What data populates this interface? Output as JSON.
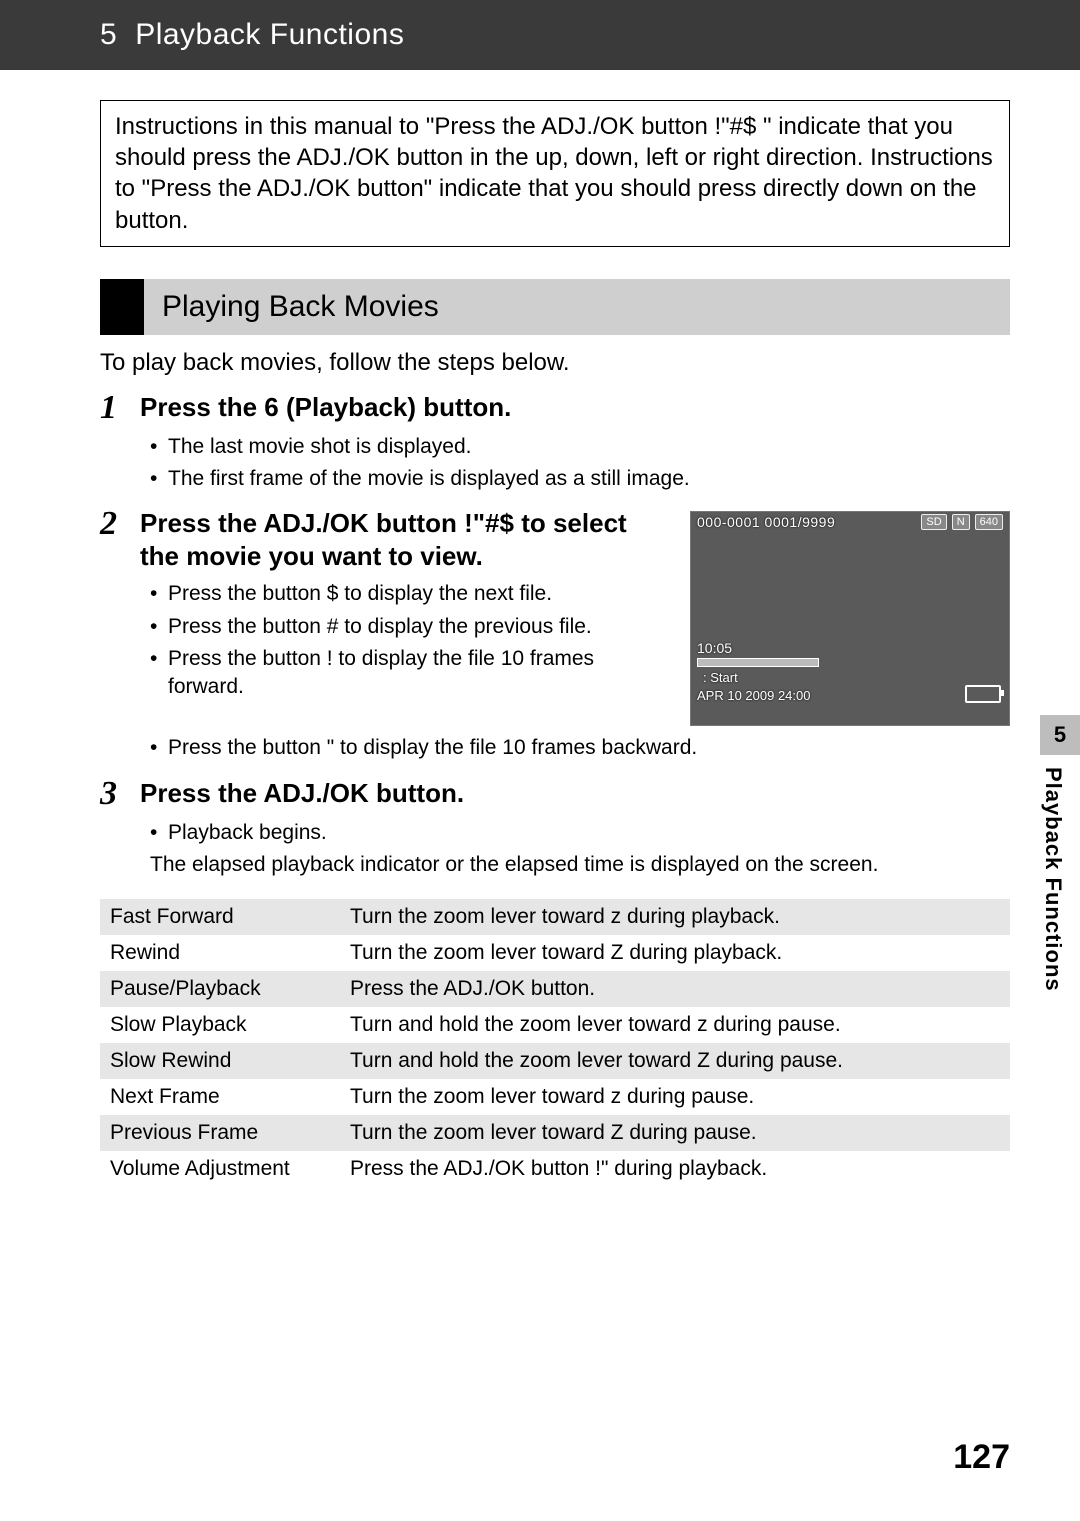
{
  "chapter": {
    "number": "5",
    "title": "Playback Functions"
  },
  "instruction_box": "Instructions in this manual to \"Press the ADJ./OK button !\"#$    \" indicate that you should press the ADJ./OK button in the up, down, left or right direction. Instructions to \"Press the ADJ./OK button\" indicate that you should press directly down on the button.",
  "section_title": "Playing Back Movies",
  "lead": "To play back movies, follow the steps below.",
  "steps": [
    {
      "num": "1",
      "title_pre": "Press the ",
      "title_sym": "6",
      "title_post": " (Playback) button.",
      "bullets": [
        "The last movie shot is displayed.",
        "The first frame of the movie is displayed as a still image."
      ]
    },
    {
      "num": "2",
      "title": "Press the ADJ./OK button !\"#$    to select the movie you want to view.",
      "bullets": [
        "Press the button $ to display the next file.",
        "Press the button # to display the previous file.",
        "Press the button !   to display the file 10 frames forward.",
        "Press the button \"   to display the file 10 frames backward."
      ]
    },
    {
      "num": "3",
      "title": "Press the ADJ./OK button.",
      "bullets": [
        "Playback begins."
      ],
      "note": "The elapsed playback indicator or the elapsed time is displayed on the screen."
    }
  ],
  "camera_screen": {
    "top_left": "000-0001 0001/9999",
    "badges": [
      "SD",
      "N",
      "640"
    ],
    "time": "10:05",
    "start": ": Start",
    "date": "APR 10 2009 24:00"
  },
  "controls_table": [
    {
      "label": "Fast Forward",
      "desc": "Turn the zoom lever toward z during playback."
    },
    {
      "label": "Rewind",
      "desc": "Turn the zoom lever toward Z during playback."
    },
    {
      "label": "Pause/Playback",
      "desc": "Press the ADJ./OK button."
    },
    {
      "label": "Slow Playback",
      "desc": "Turn and hold the zoom lever toward z during pause."
    },
    {
      "label": "Slow Rewind",
      "desc": "Turn and hold the zoom lever toward Z during pause."
    },
    {
      "label": "Next Frame",
      "desc": "Turn the zoom lever toward z during pause."
    },
    {
      "label": "Previous Frame",
      "desc": "Turn the zoom lever toward Z during pause."
    },
    {
      "label": "Volume Adjustment",
      "desc": "Press the ADJ./OK button !\" during playback."
    }
  ],
  "side_tab": {
    "num": "5",
    "label": "Playback Functions"
  },
  "page_number": "127"
}
